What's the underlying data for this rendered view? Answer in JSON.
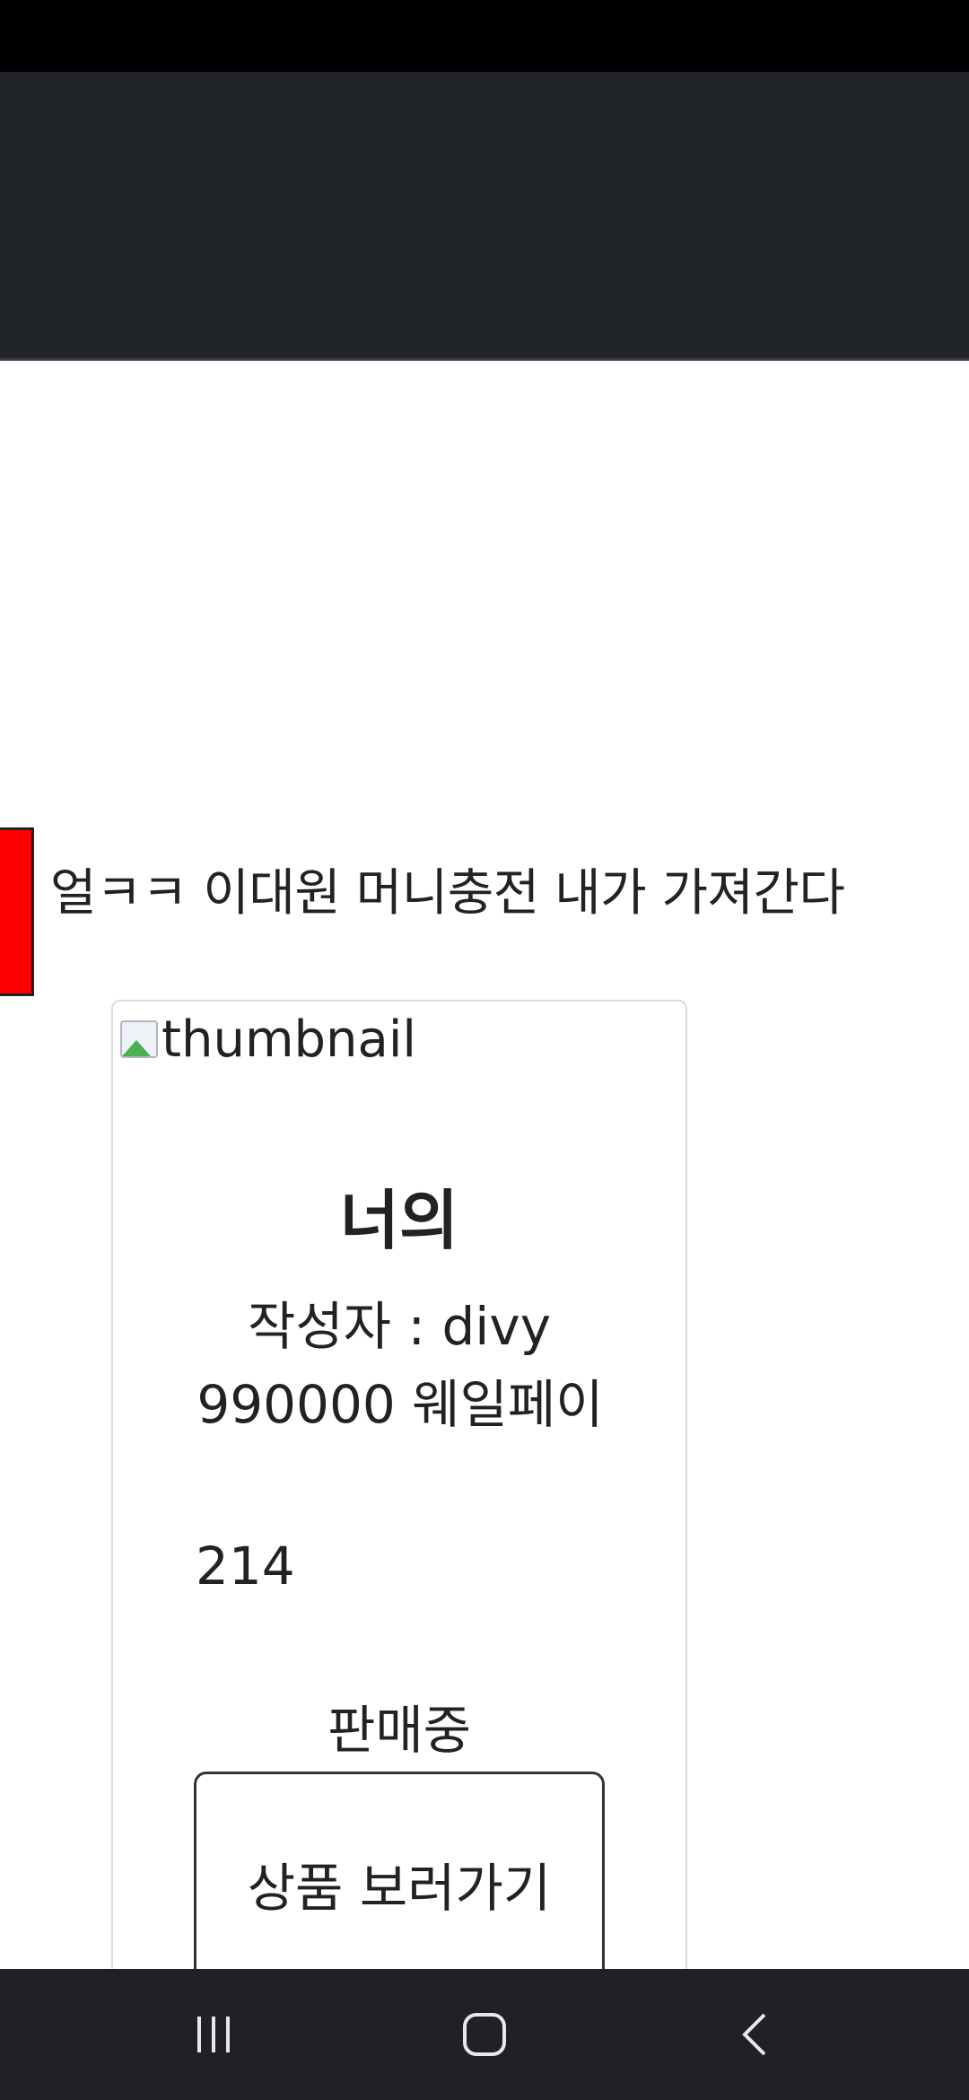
{
  "banner": {
    "text": "얼ㅋㅋ 이대원 머니충전 내가 가져간다"
  },
  "product": {
    "thumbnail_alt": "thumbnail",
    "title": "너의",
    "author": "작성자 : divy",
    "price": "990000 웨일페이",
    "count": "214",
    "status": "판매중",
    "view_button_label": "상품 보러가기"
  },
  "colors": {
    "header_bg": "#212529",
    "accent_red": "#ff0000",
    "nav_bg": "#202124"
  },
  "navigation": {
    "buttons": [
      "recent-apps-icon",
      "home-icon",
      "back-icon"
    ]
  }
}
